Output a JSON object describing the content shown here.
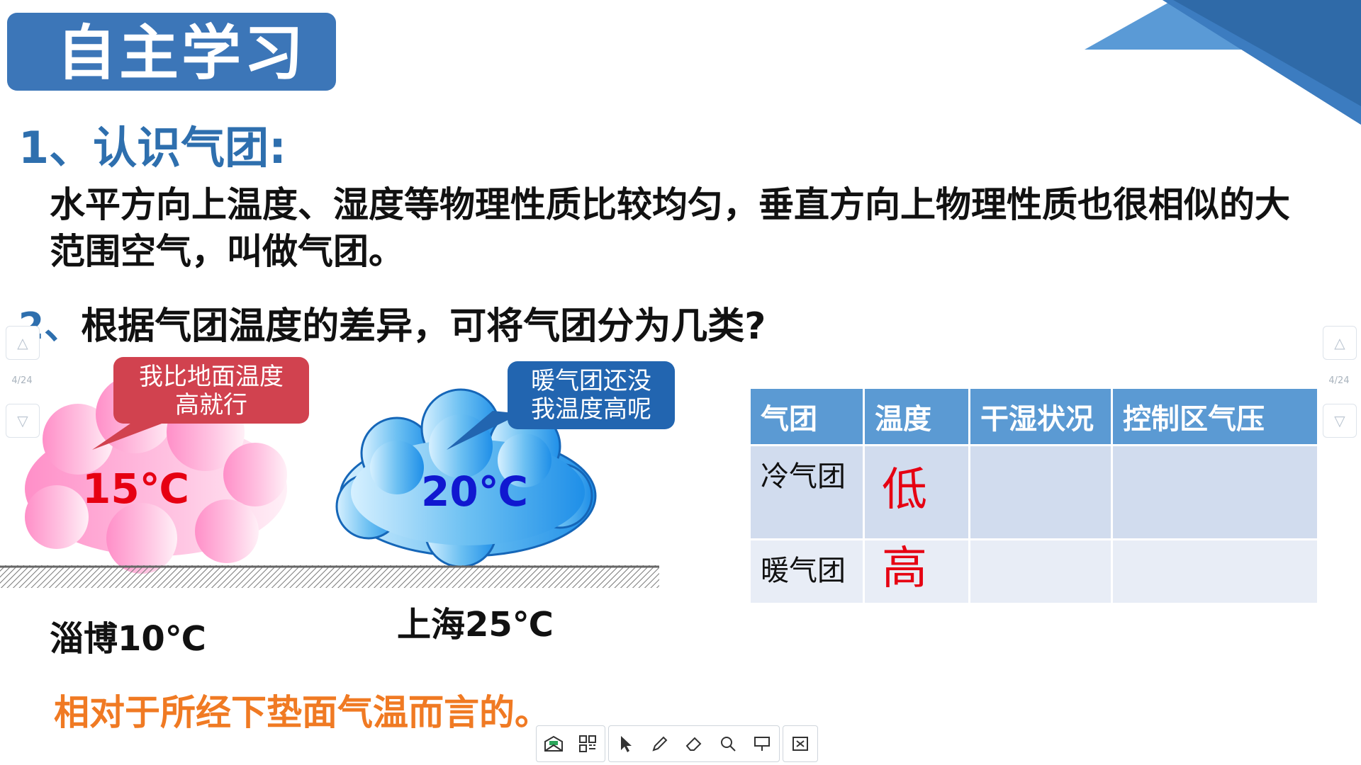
{
  "header": {
    "title": "自主学习"
  },
  "section1": {
    "heading": "1、认识气团:",
    "body": "水平方向上温度、湿度等物理性质比较均匀，垂直方向上物理性质也很相似的大范围空气，叫做气团。"
  },
  "section2": {
    "heading_num": "2、",
    "heading_text": "根据气团温度的差异，可将气团分为几类?"
  },
  "diagram": {
    "cold_cloud_temp": "15℃",
    "warm_cloud_temp": "20℃",
    "cold_bubble": [
      "我比地面温度",
      "高就行"
    ],
    "warm_bubble": [
      "暖气团还没",
      "我温度高呢"
    ],
    "left_place": "淄博10℃",
    "right_place": "上海25℃"
  },
  "conclusion": "相对于所经下垫面气温而言的。",
  "table": {
    "headers": [
      "气团",
      "温度",
      "干湿状况",
      "控制区气压"
    ],
    "rows": [
      {
        "name": "冷气团",
        "temp": "低",
        "humidity": "",
        "pressure": ""
      },
      {
        "name": "暖气团",
        "temp": "高",
        "humidity": "",
        "pressure": ""
      }
    ]
  },
  "pager": {
    "page": "4/24"
  },
  "colors": {
    "accent": "#3c76b8",
    "highlight": "#e60012",
    "orange": "#f07a23"
  },
  "toolbar": {
    "icons": [
      "slides-icon",
      "grid-icon",
      "pointer-icon",
      "pen-icon",
      "eraser-icon",
      "magnifier-icon",
      "screen-icon",
      "exit-icon"
    ]
  }
}
